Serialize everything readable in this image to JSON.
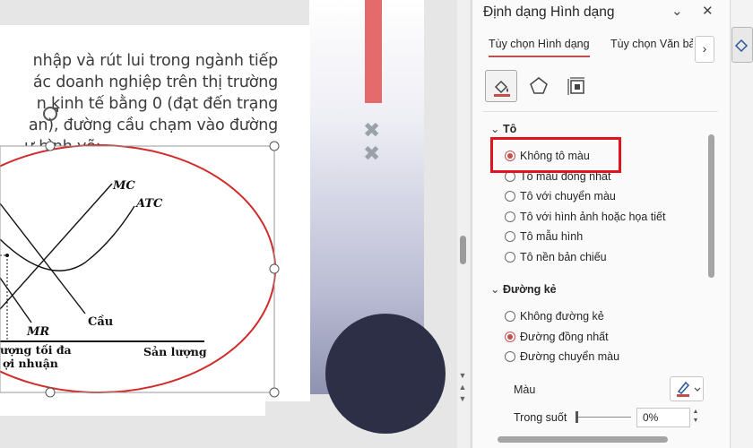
{
  "slide": {
    "text_lines": [
      "nhập và rút lui trong ngành tiếp",
      "ác doanh nghiệp trên thị trường",
      "n kinh tế bằng 0 (đạt đến trạng",
      "an), đường cầu chạm vào đường",
      "ư hình vẽ:"
    ],
    "chart_labels": {
      "mc": "MC",
      "atc": "ATC",
      "mr": "MR",
      "cau": "Cầu",
      "san_luong": "Sản lượng",
      "toi_da_line1": "ượng tối đa",
      "toi_da_line2": "ợi nhuận"
    }
  },
  "pane": {
    "title": "Định dạng Hình dạng",
    "controls": {
      "collapse": "⌄",
      "close": "✕"
    },
    "tabs": [
      {
        "label": "Tùy chọn Hình dạng"
      },
      {
        "label": "Tùy chọn Văn bản"
      }
    ],
    "tab_more": "›",
    "fill_section": {
      "title": "Tô",
      "options": [
        {
          "label": "Không tô màu",
          "selected": true
        },
        {
          "label": "Tô màu đồng nhất",
          "selected": false
        },
        {
          "label": "Tô với chuyển màu",
          "selected": false
        },
        {
          "label": "Tô với hình ảnh hoặc họa tiết",
          "selected": false
        },
        {
          "label": "Tô mẫu hình",
          "selected": false
        },
        {
          "label": "Tô nền bản chiếu",
          "selected": false
        }
      ]
    },
    "line_section": {
      "title": "Đường kẻ",
      "options": [
        {
          "label": "Không đường kẻ",
          "selected": false
        },
        {
          "label": "Đường đồng nhất",
          "selected": true
        },
        {
          "label": "Đường chuyển màu",
          "selected": false
        }
      ]
    },
    "color_label": "Màu",
    "transparency_label": "Trong suốt",
    "transparency_value": "0%",
    "accent_color": "#c0504d"
  }
}
